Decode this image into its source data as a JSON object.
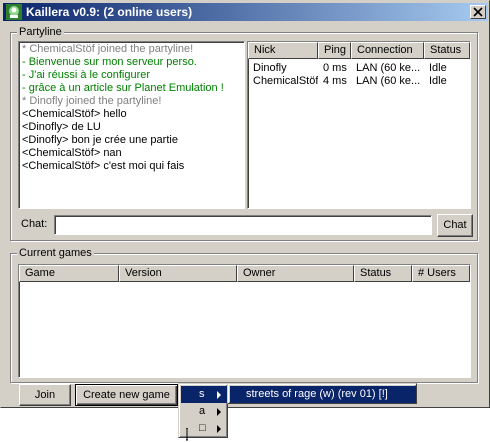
{
  "window": {
    "title": "Kaillera v0.9:  (2 online users)"
  },
  "partyline": {
    "legend": "Partyline",
    "messages": [
      {
        "text": "* ChemicalStöf joined the partyline!",
        "kind": "system"
      },
      {
        "text": "- Bienvenue sur mon serveur perso.",
        "kind": "motd"
      },
      {
        "text": "- J'ai réussi à le configurer",
        "kind": "motd"
      },
      {
        "text": "- grâce à un article sur Planet Emulation !",
        "kind": "motd"
      },
      {
        "text": "* Dinofly joined the partyline!",
        "kind": "system"
      },
      {
        "text": "<ChemicalStöf> hello",
        "kind": "chat"
      },
      {
        "text": "<Dinofly> de LU",
        "kind": "chat"
      },
      {
        "text": "<Dinofly> bon je crée une partie",
        "kind": "chat"
      },
      {
        "text": "<ChemicalStöf> nan",
        "kind": "chat"
      },
      {
        "text": "<ChemicalStöf> c'est moi qui fais",
        "kind": "chat"
      }
    ],
    "users_columns": [
      "Nick",
      "Ping",
      "Connection",
      "Status"
    ],
    "users": [
      {
        "nick": "Dinofly",
        "ping": "0 ms",
        "connection": "LAN (60 ke...",
        "status": "Idle"
      },
      {
        "nick": "ChemicalStöf",
        "ping": "4 ms",
        "connection": "LAN (60 ke...",
        "status": "Idle"
      }
    ],
    "chat_label": "Chat:",
    "chat_value": "",
    "chat_button": "Chat"
  },
  "games": {
    "legend": "Current games",
    "columns": [
      "Game",
      "Version",
      "Owner",
      "Status",
      "# Users"
    ],
    "rows": []
  },
  "buttons": {
    "join": "Join",
    "create": "Create new game"
  },
  "popup_menu": {
    "items": [
      {
        "label": "s",
        "selected": true
      },
      {
        "label": "a",
        "selected": false
      },
      {
        "label": "□",
        "selected": false
      }
    ],
    "submenu": [
      {
        "label": "streets of rage (w) (rev 01) [!]",
        "selected": true
      }
    ]
  },
  "colors": {
    "title_start": "#0a246a",
    "title_end": "#a6caf0",
    "system_msg": "#808080",
    "motd_msg": "#008000",
    "highlight": "#0a246a"
  }
}
